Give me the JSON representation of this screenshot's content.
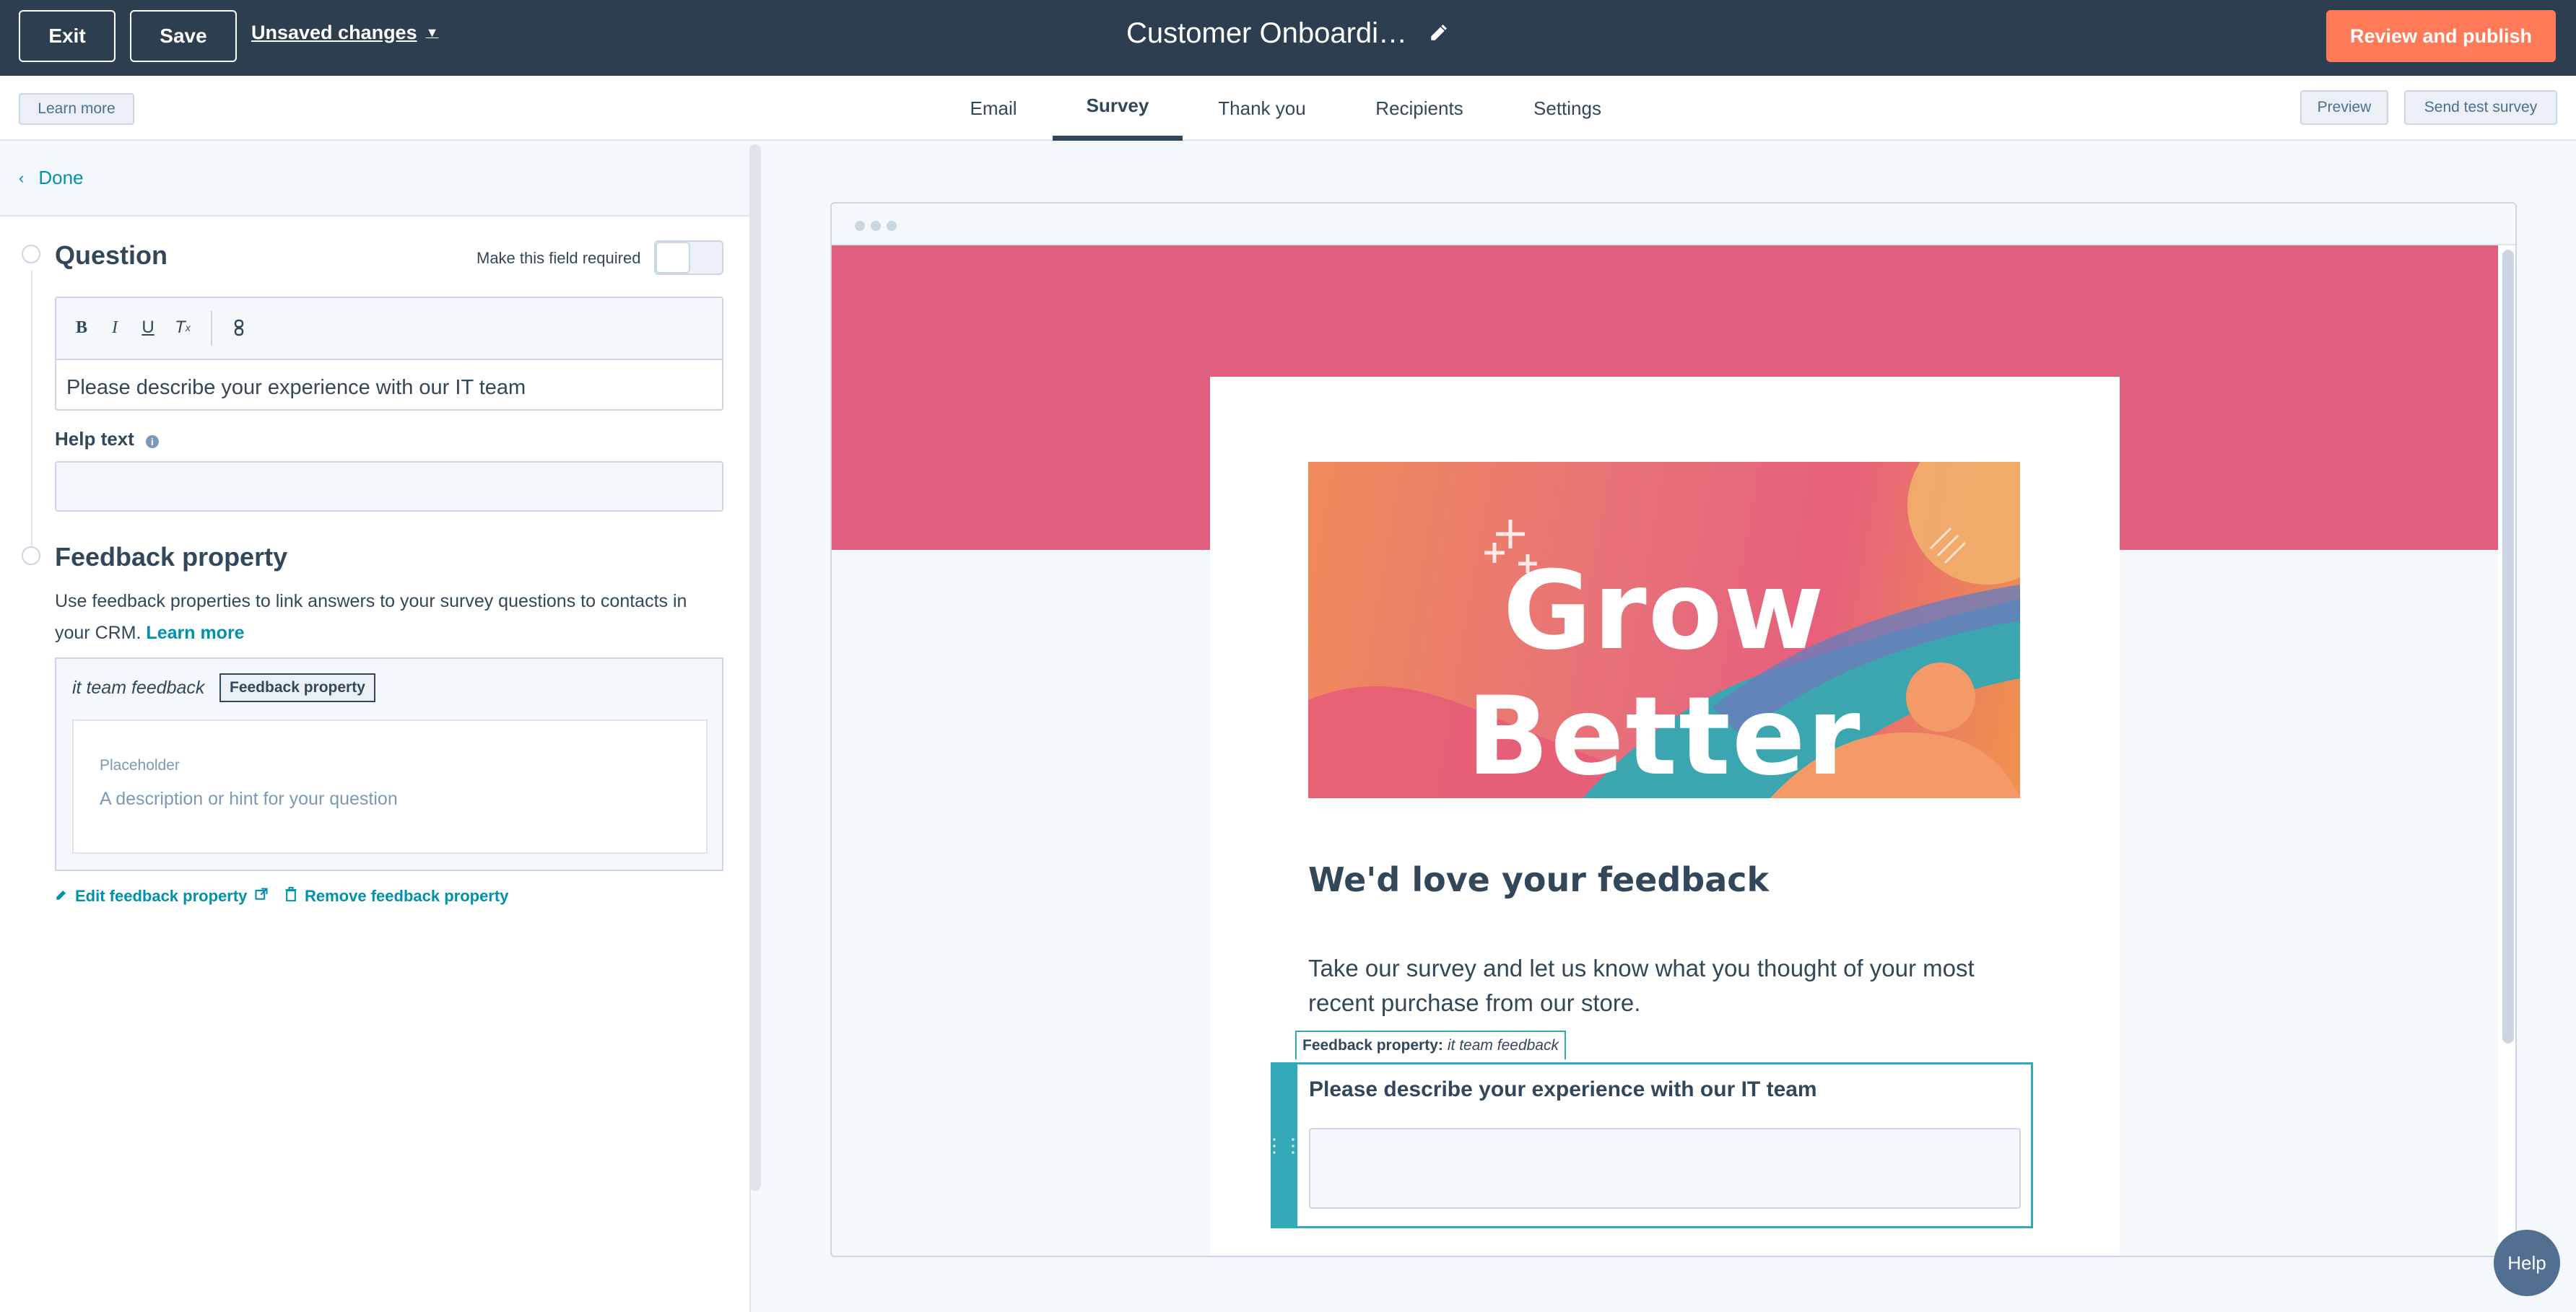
{
  "topbar": {
    "exit_label": "Exit",
    "save_label": "Save",
    "unsaved_label": "Unsaved changes",
    "title": "Customer Onboardi…",
    "review_label": "Review and publish"
  },
  "tabbar": {
    "learn_more": "Learn more",
    "tabs": [
      {
        "label": "Email"
      },
      {
        "label": "Survey"
      },
      {
        "label": "Thank you"
      },
      {
        "label": "Recipients"
      },
      {
        "label": "Settings"
      }
    ],
    "active_tab": "Survey",
    "preview_label": "Preview",
    "send_test_label": "Send test survey"
  },
  "left_panel": {
    "done_label": "Done",
    "question_title": "Question",
    "required_label": "Make this field required",
    "required_on": false,
    "question_text": "Please describe your experience with our IT team",
    "help_text_label": "Help text",
    "help_text_value": "",
    "feedback_title": "Feedback property",
    "feedback_desc": "Use feedback properties to link answers to your survey questions to contacts in your CRM.",
    "feedback_learn_more": "Learn more",
    "property_name": "it team feedback",
    "property_tag": "Feedback property",
    "placeholder_label": "Placeholder",
    "placeholder_hint": "A description or hint for your question",
    "edit_link": "Edit feedback property",
    "remove_link": "Remove feedback property"
  },
  "preview": {
    "hero_text": "Grow Better",
    "heading": "We'd love your feedback",
    "paragraph": "Take our survey and let us know what you thought of your most recent purchase from our store.",
    "fb_label_bold": "Feedback property:",
    "fb_label_value": "it team feedback",
    "question": "Please describe your experience with our IT team",
    "help_label": "Help"
  },
  "colors": {
    "topbar": "#2d3e50",
    "accent": "#ff7a59",
    "link": "#0091ae",
    "pink_band": "#e05f7e",
    "teal": "#33a9b8"
  }
}
